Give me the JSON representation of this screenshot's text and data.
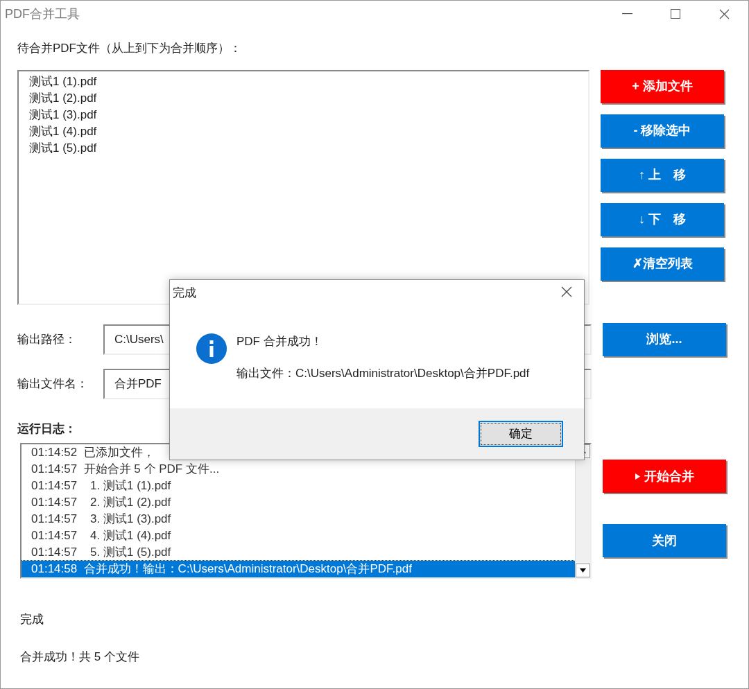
{
  "window": {
    "title": "PDF合并工具"
  },
  "file_list": {
    "label": "待合并PDF文件（从上到下为合并顺序）：",
    "items": [
      {
        "text": "测试1 (1).pdf",
        "selected": false
      },
      {
        "text": "测试1 (2).pdf",
        "selected": false
      },
      {
        "text": "测试1 (3).pdf",
        "selected": false
      },
      {
        "text": "测试1 (4).pdf",
        "selected": false
      },
      {
        "text": "测试1 (5).pdf",
        "selected": false
      }
    ]
  },
  "side_buttons": [
    {
      "label": "+ 添加文件",
      "color": "#ff0000"
    },
    {
      "label": "- 移除选中",
      "color": "#0078d7"
    },
    {
      "label": "↑ 上　移",
      "color": "#0078d7"
    },
    {
      "label": "↓ 下　移",
      "color": "#0078d7"
    },
    {
      "label": "✗清空列表",
      "color": "#0078d7"
    }
  ],
  "output_path": {
    "label": "输出路径：",
    "value": "C:\\Users\\"
  },
  "browse_button": {
    "label": "浏览...",
    "color": "#0078d7"
  },
  "output_name": {
    "label": "输出文件名：",
    "value": "合并PDF"
  },
  "log": {
    "label": "运行日志：",
    "lines": [
      {
        "text": "01:14:52  已添加文件，",
        "selected": false
      },
      {
        "text": "01:14:57  开始合并 5 个 PDF 文件...",
        "selected": false
      },
      {
        "text": "01:14:57    1. 测试1 (1).pdf",
        "selected": false
      },
      {
        "text": "01:14:57    2. 测试1 (2).pdf",
        "selected": false
      },
      {
        "text": "01:14:57    3. 测试1 (3).pdf",
        "selected": false
      },
      {
        "text": "01:14:57    4. 测试1 (4).pdf",
        "selected": false
      },
      {
        "text": "01:14:57    5. 测试1 (5).pdf",
        "selected": false
      },
      {
        "text": "01:14:58  合并成功！输出：C:\\Users\\Administrator\\Desktop\\合并PDF.pdf",
        "selected": true
      }
    ]
  },
  "start_button": {
    "label": "开始合并",
    "color": "#ff0000"
  },
  "close_button": {
    "label": "关闭",
    "color": "#0078d7"
  },
  "status": [
    "完成",
    "合并成功！共 5 个文件"
  ],
  "dialog": {
    "title": "完成",
    "message": "PDF 合并成功！",
    "detail": "输出文件：C:\\Users\\Administrator\\Desktop\\合并PDF.pdf",
    "ok_button": "确定"
  }
}
